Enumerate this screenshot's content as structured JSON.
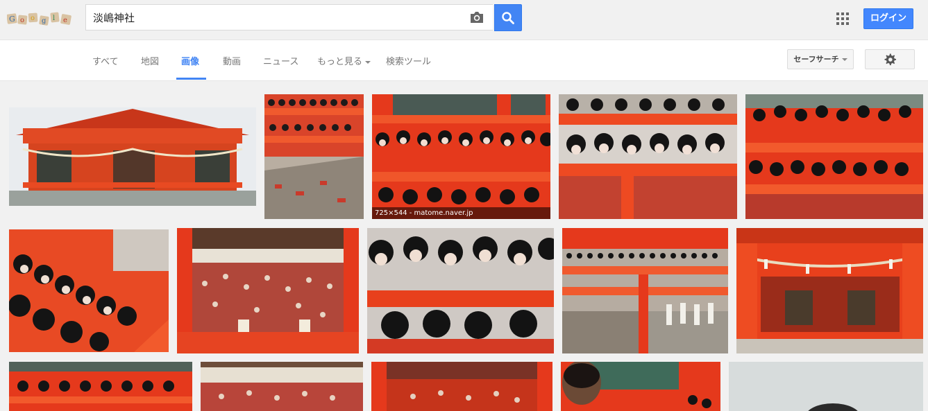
{
  "search": {
    "query": "淡嶋神社"
  },
  "header": {
    "logo_text": "Google",
    "login_label": "ログイン"
  },
  "tabs": [
    {
      "label": "すべて"
    },
    {
      "label": "地図"
    },
    {
      "label": "画像"
    },
    {
      "label": "動画"
    },
    {
      "label": "ニュース"
    },
    {
      "label": "もっと見る"
    },
    {
      "label": "検索ツール"
    }
  ],
  "active_tab": "画像",
  "safesearch_label": "セーフサーチ",
  "results": {
    "hover_caption": "725×544 - matome.naver.jp",
    "thumbnails": [
      {
        "subject": "shrine-hall"
      },
      {
        "subject": "doll-stairs"
      },
      {
        "subject": "doll-rows"
      },
      {
        "subject": "doll-rows"
      },
      {
        "subject": "doll-rows"
      },
      {
        "subject": "doll-rows"
      },
      {
        "subject": "hina-dolls"
      },
      {
        "subject": "doll-rows"
      },
      {
        "subject": "doll-stairs"
      },
      {
        "subject": "shrine-hall"
      },
      {
        "subject": "doll-rows"
      },
      {
        "subject": "hina-dolls"
      },
      {
        "subject": "hina-dolls"
      },
      {
        "subject": "doll-rows"
      },
      {
        "subject": "grey-photo"
      }
    ]
  },
  "colors": {
    "accent_blue": "#4285f4",
    "shrine_red": "#e8401c",
    "background": "#f1f1f1"
  },
  "icons": [
    "camera-icon",
    "search-icon",
    "apps-grid-icon",
    "gear-icon",
    "dropdown-caret-icon"
  ]
}
